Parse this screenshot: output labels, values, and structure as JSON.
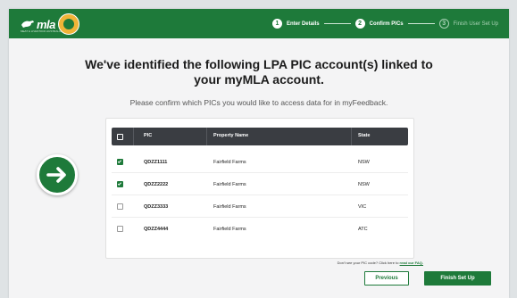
{
  "brand": {
    "logo_text": "mla",
    "logo_subtext": "MEAT & LIVESTOCK AUSTRALIA",
    "primary_color": "#1e7a3a"
  },
  "steps": [
    {
      "num": "1",
      "label": "Enter Details",
      "state": "complete"
    },
    {
      "num": "2",
      "label": "Confirm PICs",
      "state": "current"
    },
    {
      "num": "3",
      "label": "Finish User Set Up",
      "state": "upcoming"
    }
  ],
  "heading": "We've identified the following LPA PIC account(s) linked to your myMLA account.",
  "subheading": "Please confirm which PICs you would like to access data for in myFeedback.",
  "table": {
    "headers": {
      "pic": "PIC",
      "property": "Property Name",
      "state": "State"
    },
    "rows": [
      {
        "pic": "QDZZ1111",
        "property": "Fairfield Farms",
        "state": "NSW",
        "checked": true
      },
      {
        "pic": "QDZZ2222",
        "property": "Fairfield Farms",
        "state": "NSW",
        "checked": true
      },
      {
        "pic": "QDZZ3333",
        "property": "Fairfield Farms",
        "state": "VIC",
        "checked": false
      },
      {
        "pic": "QDZZ4444",
        "property": "Fairfield Farms",
        "state": "ATC",
        "checked": false
      }
    ]
  },
  "faq": {
    "text": "Don't see your PIC code? Click here to",
    "link": "read our FAQ."
  },
  "buttons": {
    "previous": "Previous",
    "finish": "Finish Set Up"
  },
  "icons": {
    "arrow": "arrow-right-icon",
    "check": "checkbox-icon",
    "badge": "seal-icon"
  }
}
